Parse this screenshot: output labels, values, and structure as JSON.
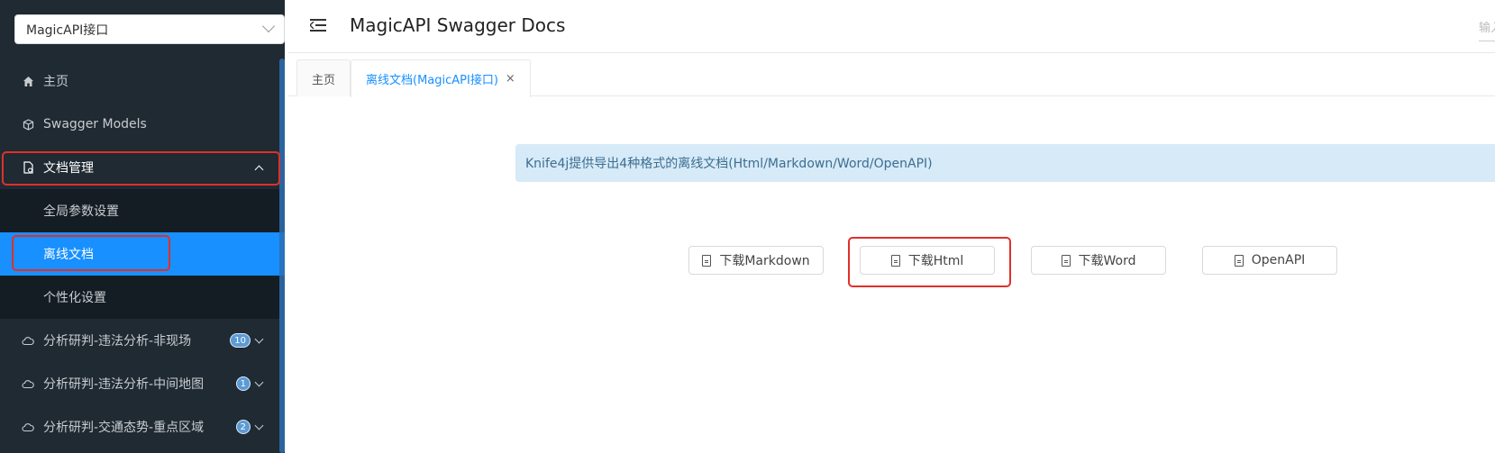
{
  "sidebar": {
    "group_select": "MagicAPI接口",
    "items": [
      {
        "label": "主页",
        "icon": "home-icon"
      },
      {
        "label": "Swagger Models",
        "icon": "cube-icon"
      },
      {
        "label": "文档管理",
        "icon": "document-icon"
      }
    ],
    "sub_items": [
      {
        "label": "全局参数设置"
      },
      {
        "label": "离线文档"
      },
      {
        "label": "个性化设置"
      }
    ],
    "groups": [
      {
        "label": "分析研判-违法分析-非现场",
        "count": "10"
      },
      {
        "label": "分析研判-违法分析-中间地图",
        "count": "1"
      },
      {
        "label": "分析研判-交通态势-重点区域",
        "count": "2"
      }
    ]
  },
  "header": {
    "title": "MagicAPI Swagger Docs",
    "search_placeholder": "输入"
  },
  "tabs": [
    {
      "label": "主页"
    },
    {
      "label": "离线文档(MagicAPI接口)",
      "close": "×"
    }
  ],
  "main": {
    "info_text": "Knife4j提供导出4种格式的离线文档(Html/Markdown/Word/OpenAPI)",
    "buttons": [
      {
        "label": "下载Markdown",
        "icon": "file-markdown-icon"
      },
      {
        "label": "下载Html",
        "icon": "file-html-icon"
      },
      {
        "label": "下载Word",
        "icon": "file-word-icon"
      },
      {
        "label": "OpenAPI",
        "icon": "file-text-icon"
      }
    ]
  },
  "colors": {
    "sidebar_bg": "#1f2a33",
    "accent": "#1890ff",
    "highlight_box": "#e0302a",
    "alert_bg": "#d6eaf8"
  }
}
